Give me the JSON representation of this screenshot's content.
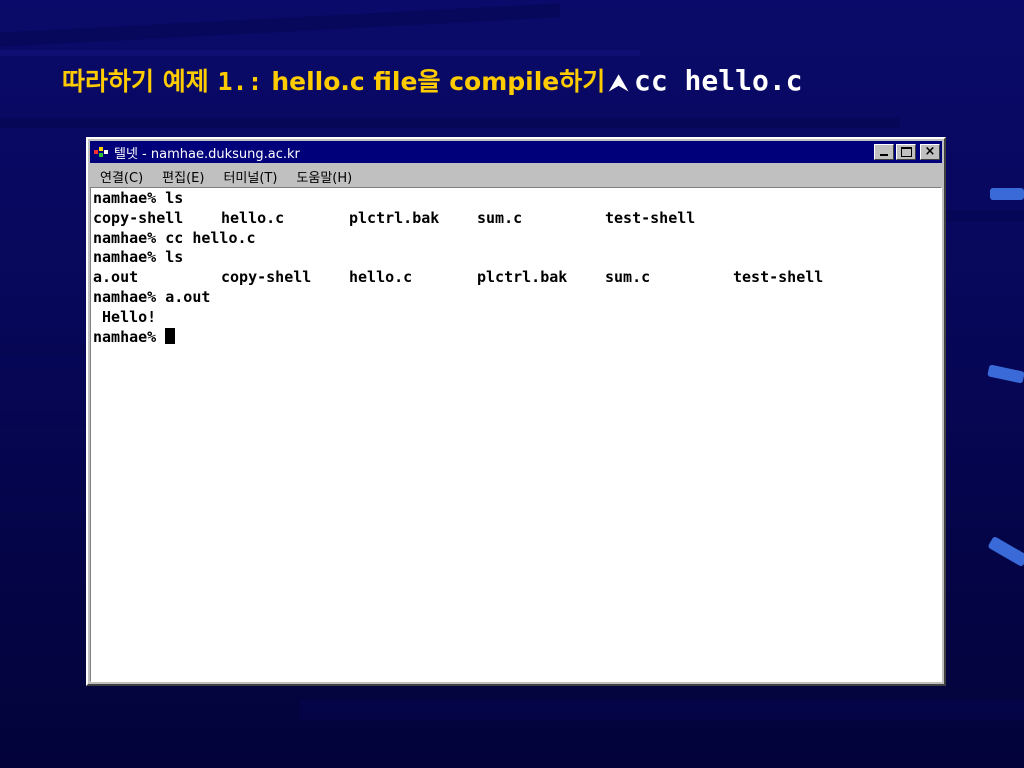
{
  "slide": {
    "title_korean": "따라하기 예제",
    "title_number": "1.:",
    "title_file": "hello.c file",
    "title_particle": "을",
    "title_compile": "compile",
    "title_suffix": "하기",
    "title_arrow": "⮝",
    "command": "cc hello.c"
  },
  "window": {
    "title": "텔넷 - namhae.duksung.ac.kr",
    "menu": [
      "연결(C)",
      "편집(E)",
      "터미널(T)",
      "도움말(H)"
    ],
    "buttons": {
      "minimize": "minimize",
      "maximize": "maximize",
      "close": "×"
    }
  },
  "terminal": {
    "lines": [
      {
        "prompt": "namhae%",
        "command": " ls"
      },
      {
        "cells": [
          "copy-shell",
          "hello.c",
          "plctrl.bak",
          "sum.c",
          "test-shell"
        ]
      },
      {
        "prompt": "namhae%",
        "command": " cc hello.c"
      },
      {
        "prompt": "namhae%",
        "command": " ls"
      },
      {
        "cells": [
          "a.out",
          "copy-shell",
          "hello.c",
          "plctrl.bak",
          "sum.c",
          "test-shell"
        ]
      },
      {
        "prompt": "namhae%",
        "command": " a.out"
      },
      {
        "output": " Hello!"
      },
      {
        "prompt": "namhae%",
        "command": " ",
        "cursor": true
      }
    ]
  },
  "colors": {
    "slide_background": "#07075a",
    "title_color": "#ffcc00",
    "titlebar": "#00007b",
    "window_face": "#c0c0c0"
  }
}
